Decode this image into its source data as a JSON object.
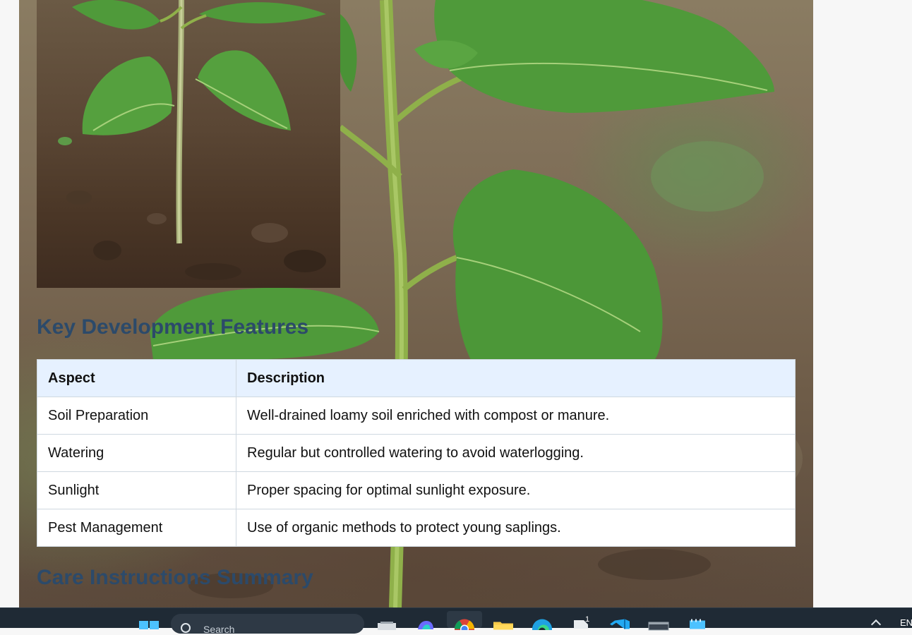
{
  "section_headings": {
    "key_features": "Key Development Features",
    "care_summary": "Care Instructions Summary"
  },
  "table": {
    "headers": [
      "Aspect",
      "Description"
    ],
    "rows": [
      {
        "aspect": "Soil Preparation",
        "description": "Well-drained loamy soil enriched with compost or manure."
      },
      {
        "aspect": "Watering",
        "description": "Regular but controlled watering to avoid waterlogging."
      },
      {
        "aspect": "Sunlight",
        "description": "Proper spacing for optimal sunlight exposure."
      },
      {
        "aspect": "Pest Management",
        "description": "Use of organic methods to protect young saplings."
      }
    ]
  },
  "taskbar": {
    "search_placeholder": "Search",
    "language": "EN",
    "badge_count": "1",
    "icons": [
      "windows-start-icon",
      "search-icon",
      "task-view-icon",
      "copilot-icon",
      "chrome-icon",
      "file-explorer-icon",
      "edge-icon",
      "file-icon",
      "vscode-icon",
      "terminal-icon",
      "notepad-icon"
    ]
  },
  "colors": {
    "heading": "#2c4a6a",
    "table_header_bg": "#e6f1ff",
    "taskbar_bg": "#1f2a35"
  }
}
